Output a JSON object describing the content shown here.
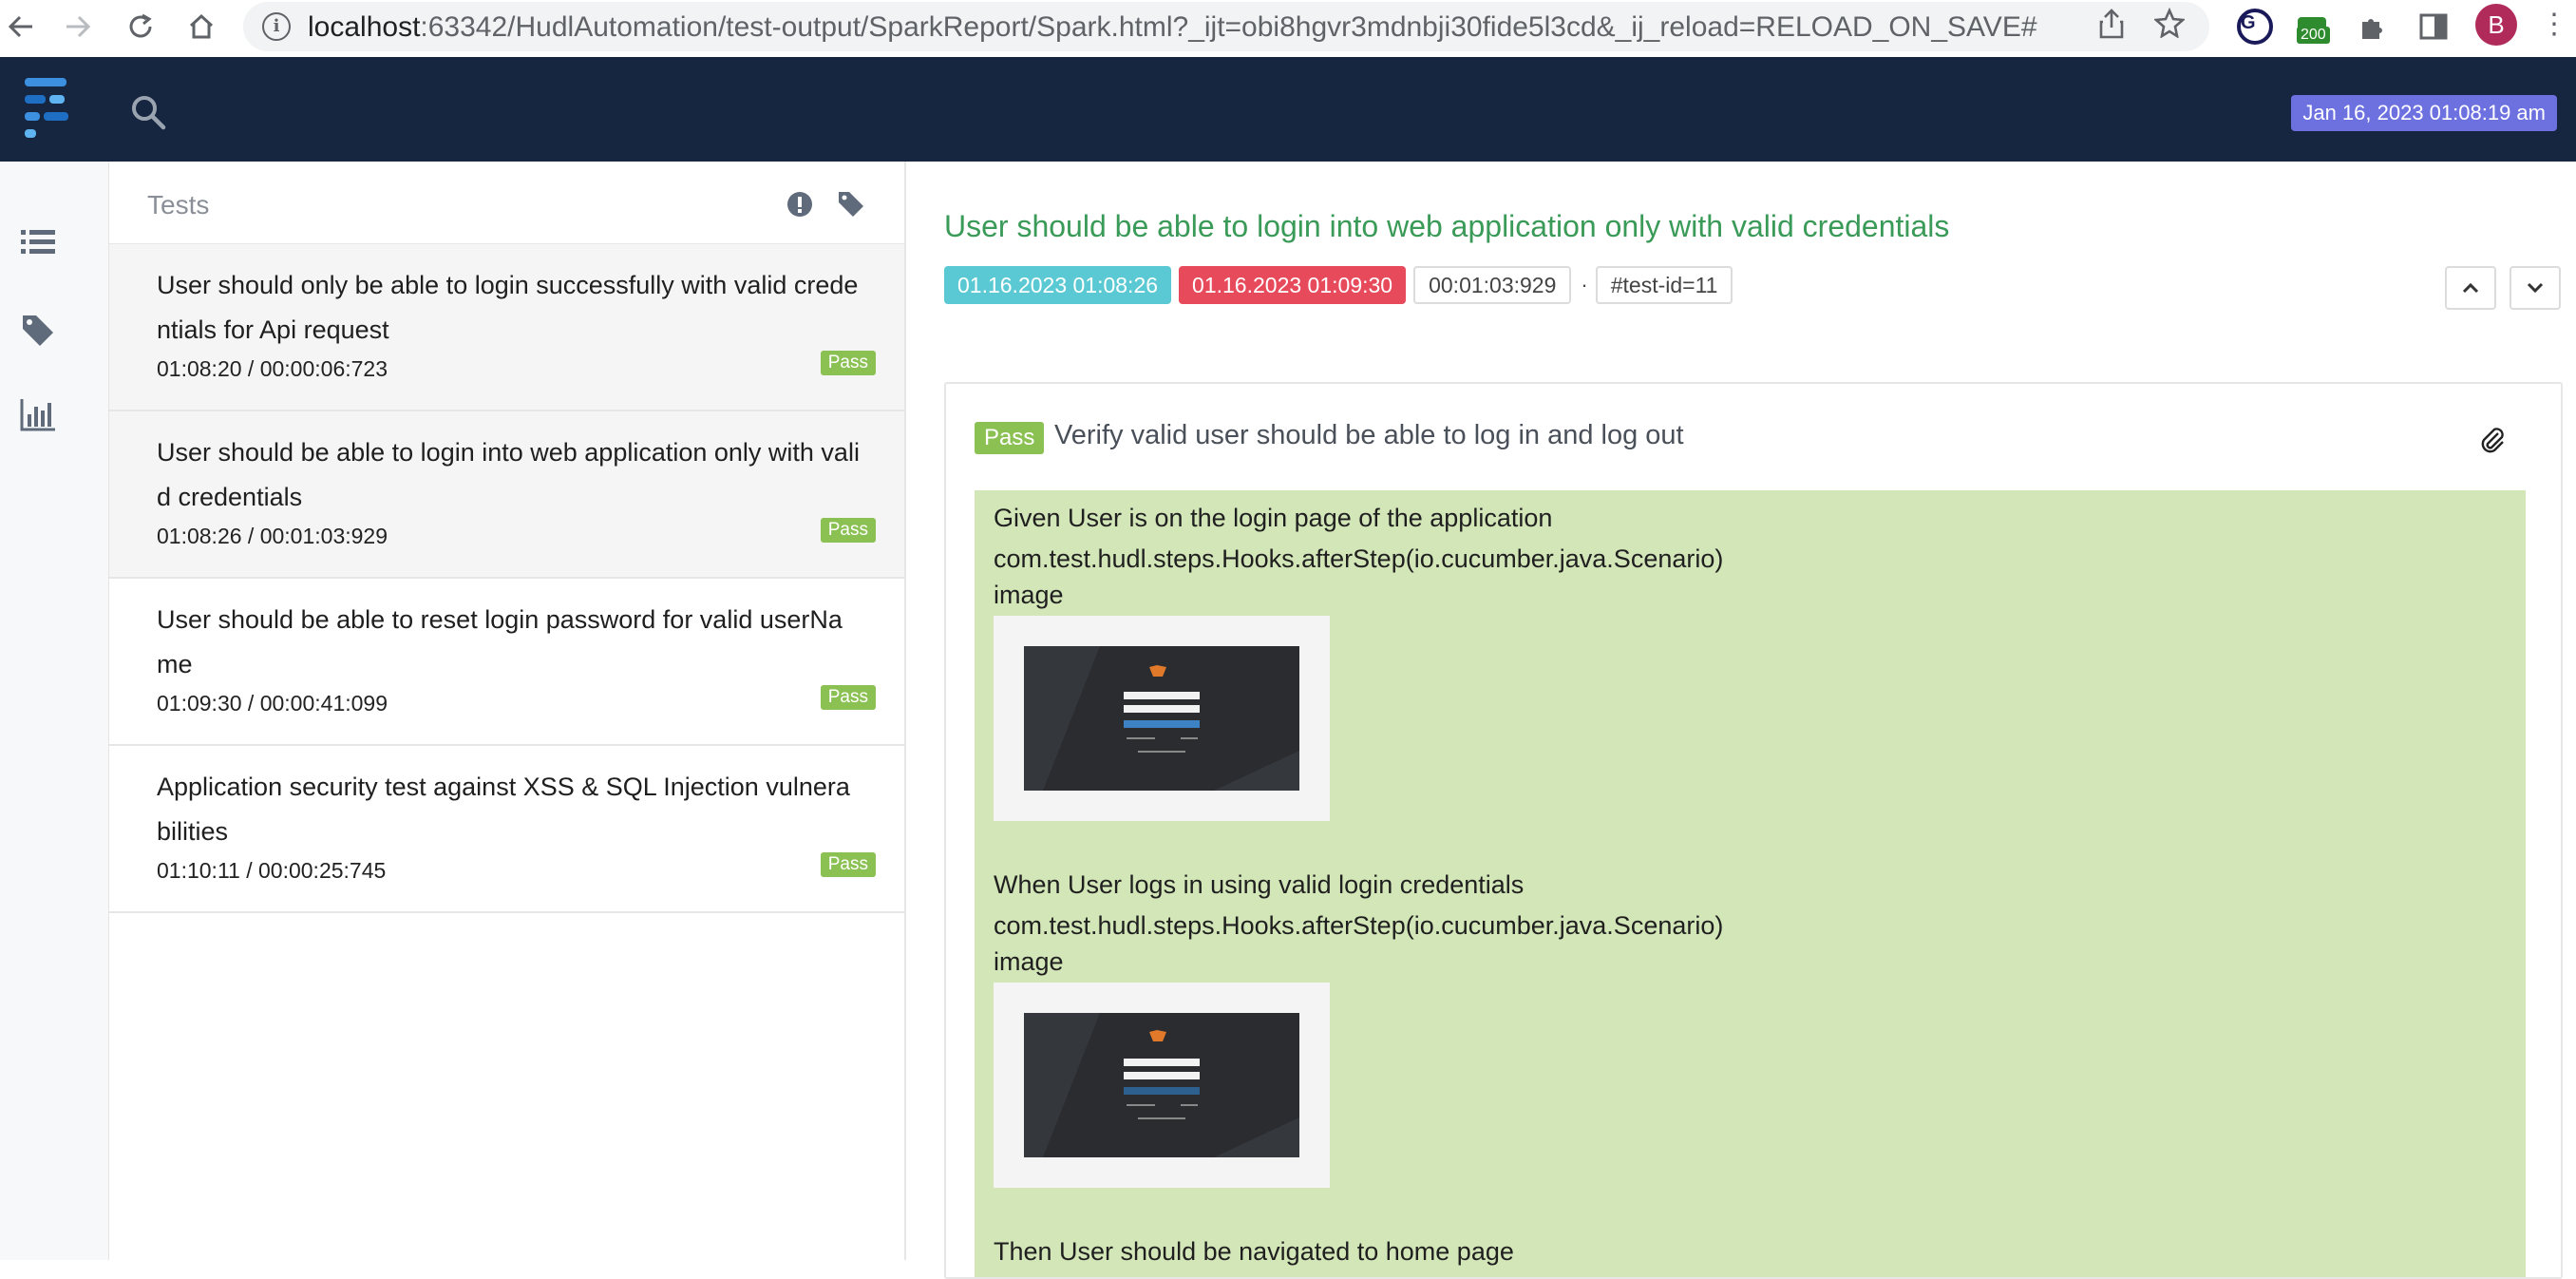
{
  "browser": {
    "url_host": "localhost",
    "url_rest": ":63342/HudlAutomation/test-output/SparkReport/Spark.html?_ijt=obi8hgvr3mdnbji30fide5l3cd&_ij_reload=RELOAD_ON_SAVE#",
    "ext_badge": "200",
    "avatar_initial": "B"
  },
  "header": {
    "date_badge": "Jan 16, 2023 01:08:19 am"
  },
  "test_list": {
    "title": "Tests",
    "items": [
      {
        "name": "User should only be able to login successfully with valid credentials for Api request",
        "time": "01:08:20 / 00:00:06:723",
        "status": "Pass",
        "active": true
      },
      {
        "name": "User should be able to login into web application only with valid credentials",
        "time": "01:08:26 / 00:01:03:929",
        "status": "Pass",
        "active": true
      },
      {
        "name": "User should be able to reset login password for valid userName",
        "time": "01:09:30 / 00:00:41:099",
        "status": "Pass",
        "active": false
      },
      {
        "name": "Application security test against XSS & SQL Injection vulnerabilities",
        "time": "01:10:11 / 00:00:25:745",
        "status": "Pass",
        "active": false
      }
    ]
  },
  "detail": {
    "title": "User should be able to login into web application only with valid credentials",
    "start": "01.16.2023 01:08:26",
    "end": "01.16.2023 01:09:30",
    "duration": "00:01:03:929",
    "separator": "·",
    "test_id": "#test-id=11",
    "scenario": {
      "status": "Pass",
      "name": "Verify valid user should be able to log in and log out",
      "steps": [
        {
          "text": "Given User is on the login page of the application",
          "hook": "com.test.hudl.steps.Hooks.afterStep(io.cucumber.java.Scenario)",
          "image_label": "image"
        },
        {
          "text": "When User logs in using valid login credentials",
          "hook": "com.test.hudl.steps.Hooks.afterStep(io.cucumber.java.Scenario)",
          "image_label": "image"
        },
        {
          "text": "Then User should be navigated to home page"
        }
      ]
    }
  },
  "colors": {
    "header_bg": "#162640",
    "pass": "#8bc152",
    "title_green": "#3a9a57",
    "start_chip": "#5bc9d3",
    "end_chip": "#e74a5b",
    "date_badge": "#6d71e0",
    "step_bg": "#d3e6b8"
  }
}
